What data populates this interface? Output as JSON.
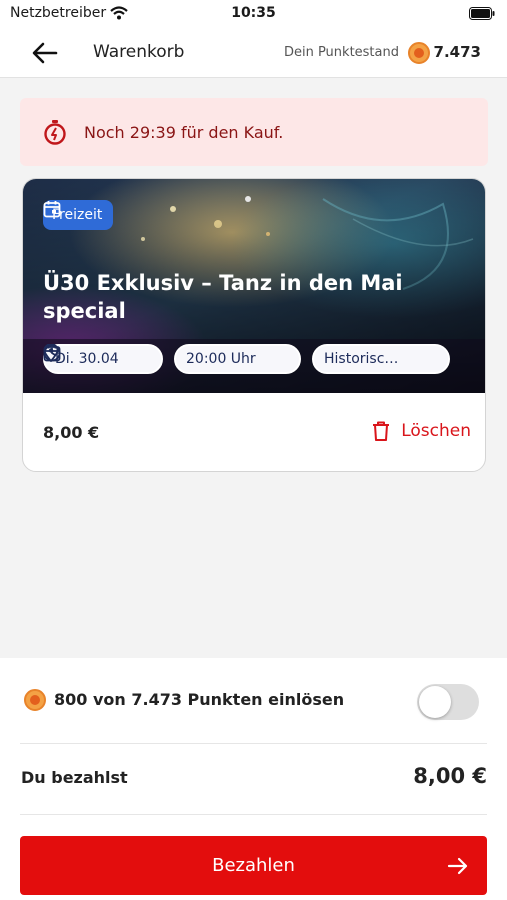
{
  "status_bar": {
    "carrier": "Netzbetreiber",
    "time": "10:35"
  },
  "header": {
    "title": "Warenkorb",
    "points_label": "Dein Punktestand",
    "points_value": "7.473"
  },
  "timer": {
    "text": "Noch 29:39 für den Kauf."
  },
  "event": {
    "category": "Freizeit",
    "title": "Ü30 Exklusiv – Tanz in den Mai special",
    "date": "Di. 30.04",
    "time": "20:00 Uhr",
    "location": "Historisc…",
    "price": "8,00 €",
    "delete_label": "Löschen"
  },
  "redeem": {
    "text": "800 von 7.473 Punkten einlösen",
    "enabled": false
  },
  "payment": {
    "label": "Du bezahlst",
    "amount": "8,00 €",
    "button_label": "Bezahlen"
  },
  "colors": {
    "accent_red": "#e30d0d",
    "banner_bg": "#fde7e7",
    "category_blue": "#2f6bd7",
    "coin_orange": "#f4a245"
  }
}
